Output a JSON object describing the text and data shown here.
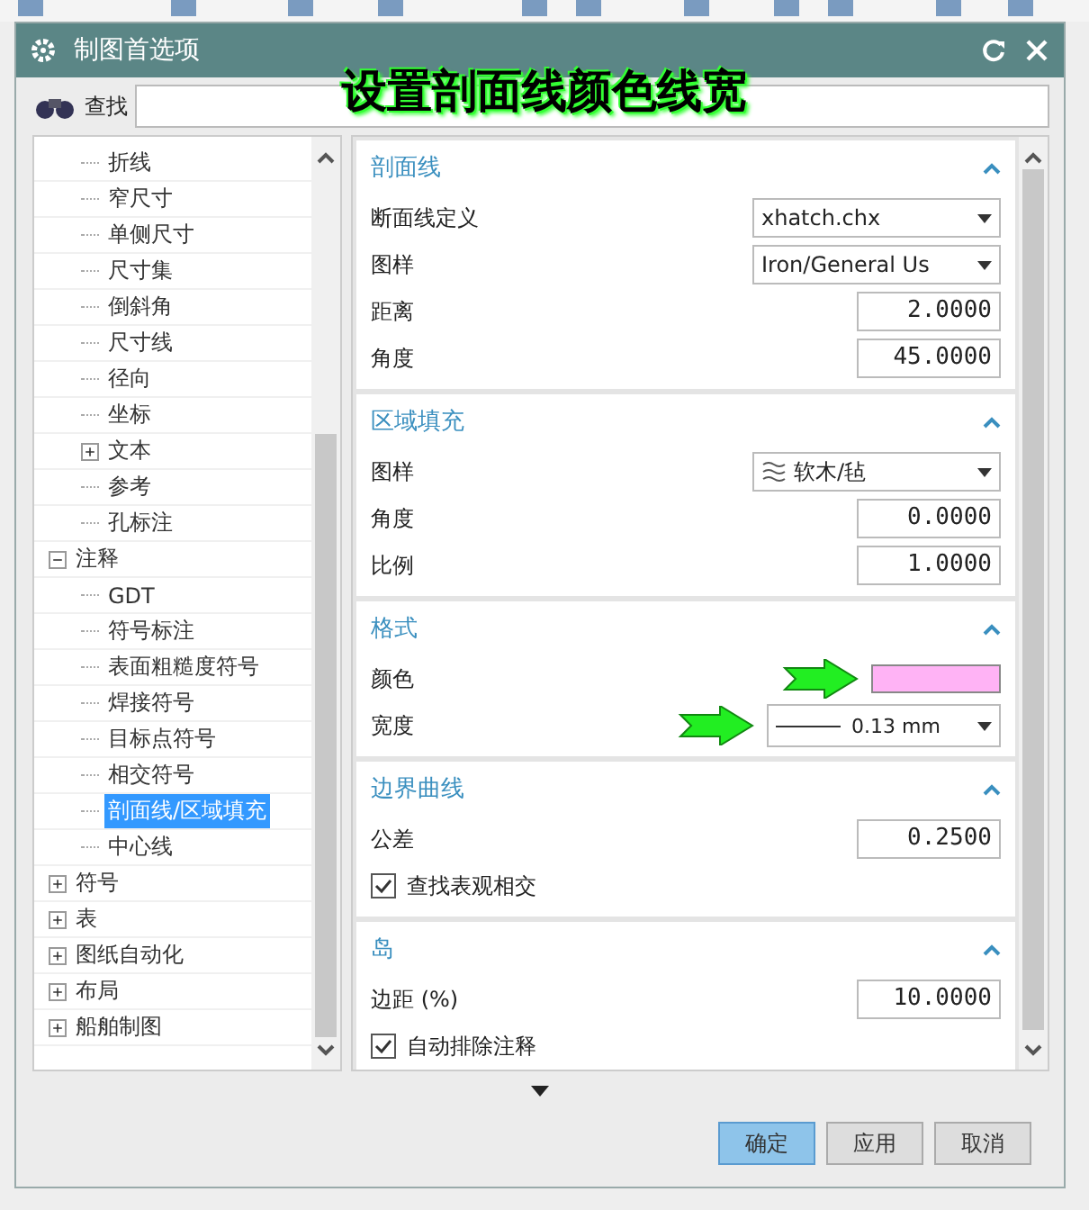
{
  "window": {
    "title": "制图首选项"
  },
  "caption": "设置剖面线颜色线宽",
  "search": {
    "label": "查找"
  },
  "tree": {
    "items": [
      {
        "children": [
          {
            "label": "折线",
            "selected": false
          },
          {
            "label": "窄尺寸",
            "selected": false
          },
          {
            "label": "单侧尺寸",
            "selected": false
          },
          {
            "label": "尺寸集",
            "selected": false
          },
          {
            "label": "倒斜角",
            "selected": false
          },
          {
            "label": "尺寸线",
            "selected": false
          },
          {
            "label": "径向",
            "selected": false
          },
          {
            "label": "坐标",
            "selected": false
          },
          {
            "label": "文本",
            "selected": false,
            "expanded": false
          },
          {
            "label": "参考",
            "selected": false
          },
          {
            "label": "孔标注",
            "selected": false
          }
        ]
      },
      {
        "label": "注释",
        "selected": false,
        "expanded": true,
        "children": [
          {
            "label": "GDT",
            "selected": false
          },
          {
            "label": "符号标注",
            "selected": false
          },
          {
            "label": "表面粗糙度符号",
            "selected": false
          },
          {
            "label": "焊接符号",
            "selected": false
          },
          {
            "label": "目标点符号",
            "selected": false
          },
          {
            "label": "相交符号",
            "selected": false
          },
          {
            "label": "剖面线/区域填充",
            "selected": true
          },
          {
            "label": "中心线",
            "selected": false
          }
        ]
      },
      {
        "label": "符号",
        "selected": false,
        "expanded": false
      },
      {
        "label": "表",
        "selected": false,
        "expanded": false
      },
      {
        "label": "图纸自动化",
        "selected": false,
        "expanded": false
      },
      {
        "label": "布局",
        "selected": false,
        "expanded": false
      },
      {
        "label": "船舶制图",
        "selected": false,
        "expanded": false
      }
    ]
  },
  "sections": [
    {
      "title": "剖面线",
      "expanded": true,
      "rows": [
        {
          "kind": "dropdown",
          "label": "断面线定义",
          "value": "xhatch.chx"
        },
        {
          "kind": "dropdown",
          "label": "图样",
          "value": "Iron/General Us"
        },
        {
          "kind": "number",
          "label": "距离",
          "value": "2.0000"
        },
        {
          "kind": "number",
          "label": "角度",
          "value": "45.0000"
        }
      ]
    },
    {
      "title": "区域填充",
      "expanded": true,
      "rows": [
        {
          "kind": "pattern",
          "label": "图样",
          "value": "软木/毡"
        },
        {
          "kind": "number",
          "label": "角度",
          "value": "0.0000"
        },
        {
          "kind": "number",
          "label": "比例",
          "value": "1.0000"
        }
      ]
    },
    {
      "title": "格式",
      "expanded": true,
      "rows": [
        {
          "kind": "color",
          "label": "颜色",
          "color": "#ffb3f5",
          "pointer": true
        },
        {
          "kind": "linewidth",
          "label": "宽度",
          "value": "0.13 mm",
          "pointer": true
        }
      ]
    },
    {
      "title": "边界曲线",
      "expanded": true,
      "rows": [
        {
          "kind": "number",
          "label": "公差",
          "value": "0.2500"
        },
        {
          "kind": "checkbox",
          "label": "查找表观相交",
          "checked": true
        }
      ]
    },
    {
      "title": "岛",
      "expanded": true,
      "rows": [
        {
          "kind": "number",
          "label": "边距 (%)",
          "value": "10.0000"
        },
        {
          "kind": "checkbox",
          "label": "自动排除注释",
          "checked": true
        }
      ]
    }
  ],
  "buttons": [
    {
      "label": "确定",
      "selected": true
    },
    {
      "label": "应用",
      "selected": false
    },
    {
      "label": "取消",
      "selected": false
    }
  ]
}
